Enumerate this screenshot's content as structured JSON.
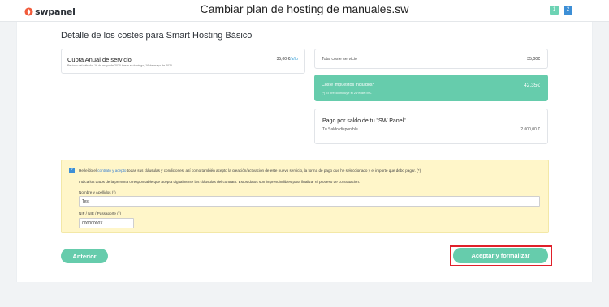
{
  "header": {
    "brand": "swpanel",
    "title": "Cambiar plan de hosting de manuales.sw",
    "steps": [
      "1",
      "2"
    ]
  },
  "section_title": "Detalle de los costes para Smart Hosting Básico",
  "fee": {
    "name": "Cuota Anual de servicio",
    "period": "Período del sábado, 16 de mayo de 2020 hasta el domingo, 16 de mayo de 2021",
    "price": "35,00 €",
    "unit": "/año"
  },
  "total": {
    "label": "Total coste servicio",
    "value": "35,00€"
  },
  "taxes": {
    "label": "Coste impuestos incluidos*",
    "value": "42,35€",
    "note": "(*) El precio incluye el 21% de IVA."
  },
  "payment": {
    "title": "Pago por saldo de tu \"SW Panel\".",
    "label": "Tu Saldo disponible",
    "value": "2.000,00 €"
  },
  "legal": {
    "check_glyph": "✓",
    "pre": "He leído el ",
    "link": "contrato y acepto",
    "post": " todas sus cláusulas y condiciones, así como también acepto la creación/activación de este nuevo servicio, la forma de pago que he seleccionado y el importe que debo pagar.  (*)",
    "info": "Indica los datos de la persona o responsable que acepta digitalmente las cláusulas del contrato. Estos datos son imprescindibles para finalizar el proceso de contratación.",
    "name_label": "Nombre y Apellidos (*)",
    "name_value": "Test",
    "nif_label": "NIF / NIE / Passaporte (*)",
    "nif_value": "00000000X"
  },
  "buttons": {
    "prev": "Anterior",
    "accept": "Aceptar y formalizar"
  },
  "colors": {
    "accent": "#66ccac",
    "blue": "#3d8fd6",
    "highlight": "#e0202a",
    "notice": "#fff6c9"
  }
}
